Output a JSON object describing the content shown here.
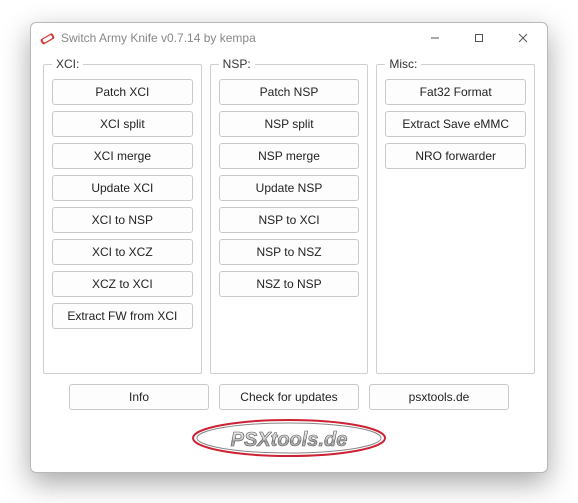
{
  "window": {
    "title": "Switch Army Knife v0.7.14 by kempa"
  },
  "groups": {
    "xci": {
      "legend": "XCI:",
      "buttons": [
        "Patch XCI",
        "XCI split",
        "XCI merge",
        "Update XCI",
        "XCI to NSP",
        "XCI to XCZ",
        "XCZ to XCI",
        "Extract FW from XCI"
      ]
    },
    "nsp": {
      "legend": "NSP:",
      "buttons": [
        "Patch NSP",
        "NSP split",
        "NSP merge",
        "Update NSP",
        "NSP to XCI",
        "NSP to NSZ",
        "NSZ to NSP"
      ]
    },
    "misc": {
      "legend": "Misc:",
      "buttons": [
        "Fat32 Format",
        "Extract Save eMMC",
        "NRO forwarder"
      ]
    }
  },
  "bottom": {
    "info": "Info",
    "check_updates": "Check for updates",
    "site": "psxtools.de"
  },
  "logo_text": "PSXtools.de"
}
